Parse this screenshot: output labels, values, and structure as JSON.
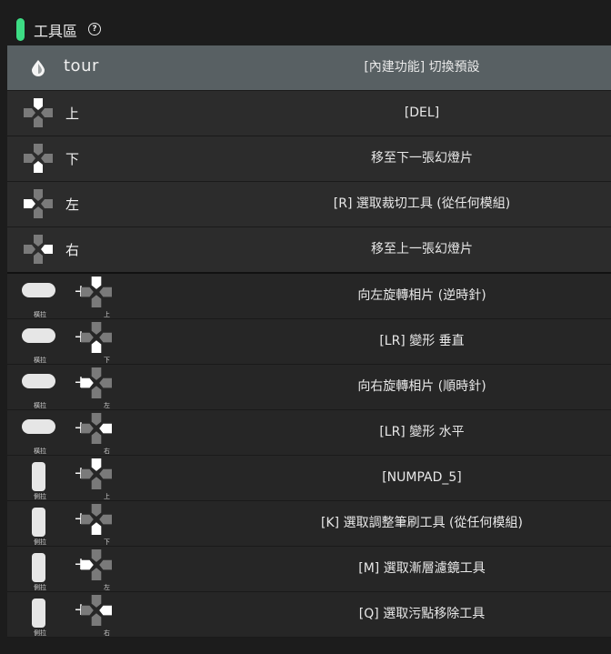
{
  "header": {
    "title": "工具區",
    "help_glyph": "?"
  },
  "rows": [
    {
      "button": "tour",
      "action": "[內建功能] 切換預設"
    },
    {
      "button": "上",
      "action": "[DEL]"
    },
    {
      "button": "下",
      "action": "移至下一張幻燈片"
    },
    {
      "button": "左",
      "action": "[R] 選取裁切工具 (從任何模組)"
    },
    {
      "button": "右",
      "action": "移至上一張幻燈片"
    },
    {
      "modifier": "橫拉",
      "direction": "上",
      "action": "向左旋轉相片 (逆時針)"
    },
    {
      "modifier": "橫拉",
      "direction": "下",
      "action": "[LR] 變形 垂直"
    },
    {
      "modifier": "橫拉",
      "direction": "左",
      "action": "向右旋轉相片 (順時針)"
    },
    {
      "modifier": "橫拉",
      "direction": "右",
      "action": "[LR] 變形 水平"
    },
    {
      "modifier": "側拉",
      "direction": "上",
      "action": "[NUMPAD_5]"
    },
    {
      "modifier": "側拉",
      "direction": "下",
      "action": "[K] 選取調整筆刷工具 (從任何模組)"
    },
    {
      "modifier": "側拉",
      "direction": "左",
      "action": "[M] 選取漸層濾鏡工具"
    },
    {
      "modifier": "側拉",
      "direction": "右",
      "action": "[Q] 選取污點移除工具"
    }
  ],
  "plus_glyph": "+",
  "colors": {
    "accent": "#3ddc84",
    "active_row": "#586063",
    "row": "#262626",
    "highlight_arm": "#ffffff",
    "dim_arm": "#7a7a7a"
  },
  "icons": {
    "tour": "drop-icon",
    "dpad": "dpad-icon",
    "horizontal_bar": "horizontal-pill-icon",
    "vertical_bar": "vertical-pill-icon"
  }
}
